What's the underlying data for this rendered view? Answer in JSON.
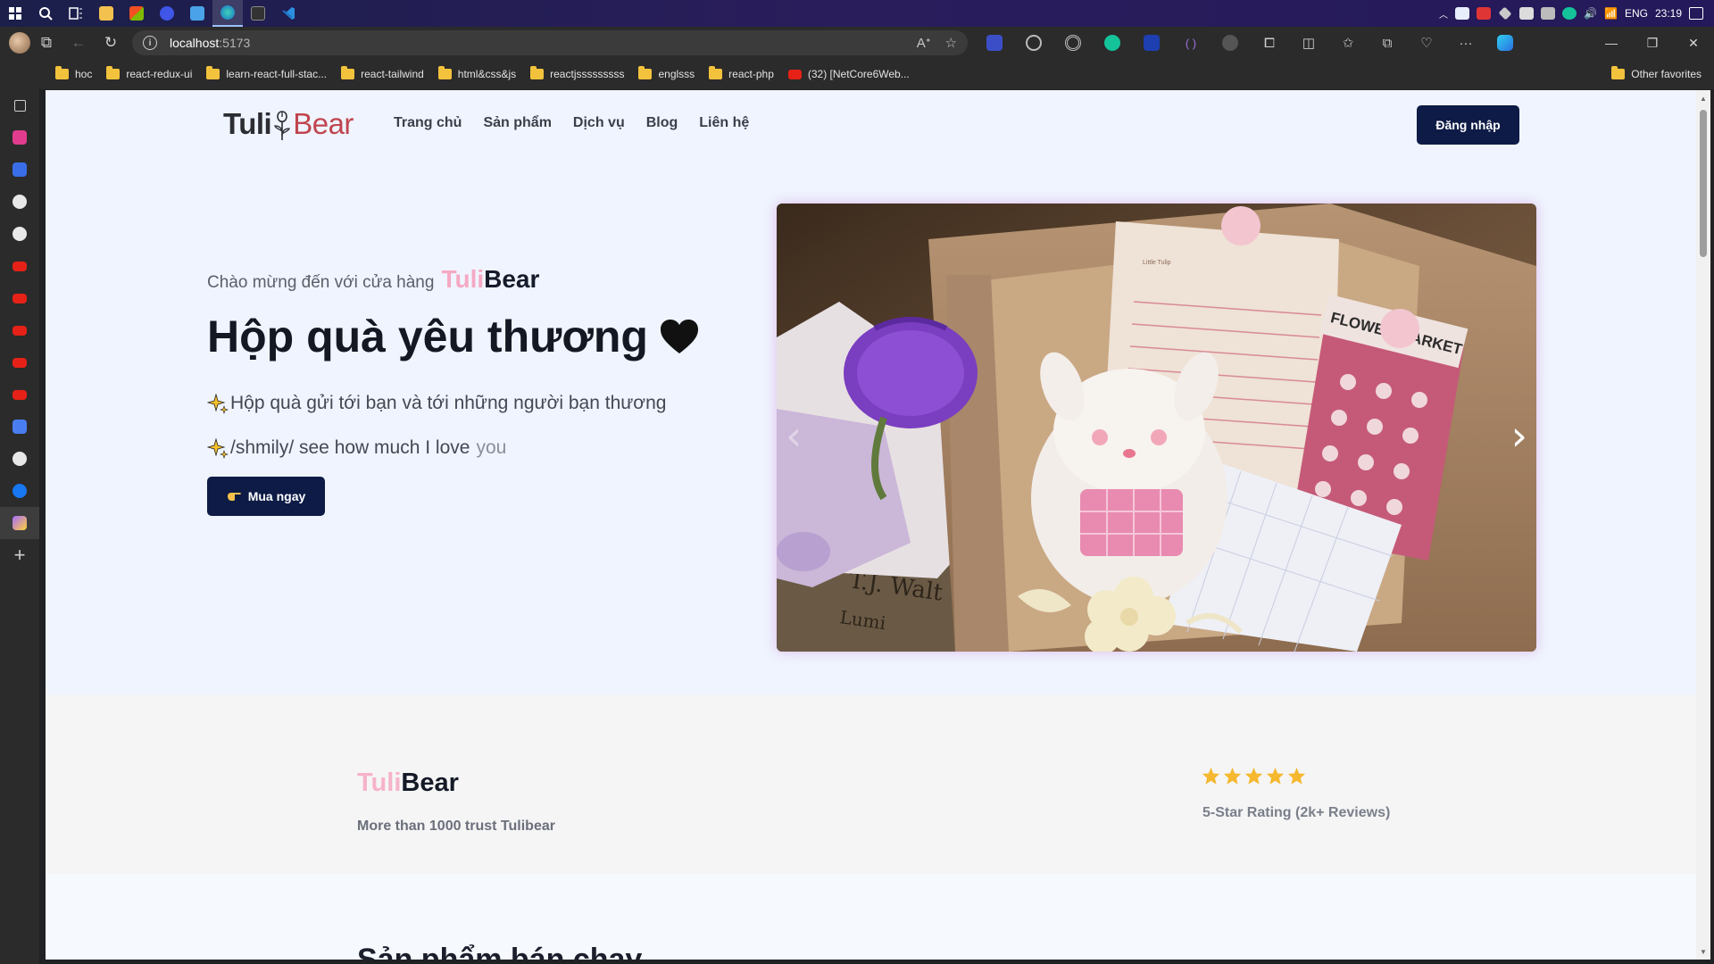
{
  "taskbar": {
    "lang": "ENG",
    "time": "23:19"
  },
  "browser": {
    "address_host": "localhost",
    "address_port": ":5173",
    "bookmarks": [
      {
        "label": "hoc",
        "type": "folder"
      },
      {
        "label": "react-redux-ui",
        "type": "folder"
      },
      {
        "label": "learn-react-full-stac...",
        "type": "folder"
      },
      {
        "label": "react-tailwind",
        "type": "folder"
      },
      {
        "label": "html&css&js",
        "type": "folder"
      },
      {
        "label": "reactjsssssssss",
        "type": "folder"
      },
      {
        "label": "englsss",
        "type": "folder"
      },
      {
        "label": "react-php",
        "type": "folder"
      },
      {
        "label": "(32) [NetCore6Web...",
        "type": "youtube"
      }
    ],
    "other_favorites": "Other favorites"
  },
  "nav": {
    "logo_tuli": "Tuli",
    "logo_bear": "Bear",
    "menu": [
      "Trang chủ",
      "Sản phẩm",
      "Dịch vụ",
      "Blog",
      "Liên hệ"
    ],
    "login": "Đăng nhập"
  },
  "hero": {
    "welcome": "Chào mừng đến với cửa hàng",
    "brand_pink": "Tuli",
    "brand_dark": "Bear",
    "title": "Hộp quà yêu thương",
    "line1": "Hộp quà gửi tới bạn và tới những người bạn thương",
    "line2_main": "/shmily/ see how much I love",
    "line2_tail": "you",
    "buy": "Mua ngay",
    "image_texts": {
      "flower_market": "FLOWER MARKET",
      "note_small": "Little Tulip",
      "newspaper": "T.J. Walt",
      "newspaper2": "Lumi"
    }
  },
  "trust": {
    "brand_pink": "Tuli",
    "brand_dark": "Bear",
    "text": "More than 1000 trust Tulibear",
    "stars": 5,
    "rating": "5-Star Rating (2k+ Reviews)"
  },
  "next_section": {
    "title": "Sản phẩm bán chạy"
  },
  "colors": {
    "primary": "#0d1b46",
    "pink": "#f6a9c3",
    "page_bg": "#eff4fe",
    "star": "#f5b82e"
  }
}
